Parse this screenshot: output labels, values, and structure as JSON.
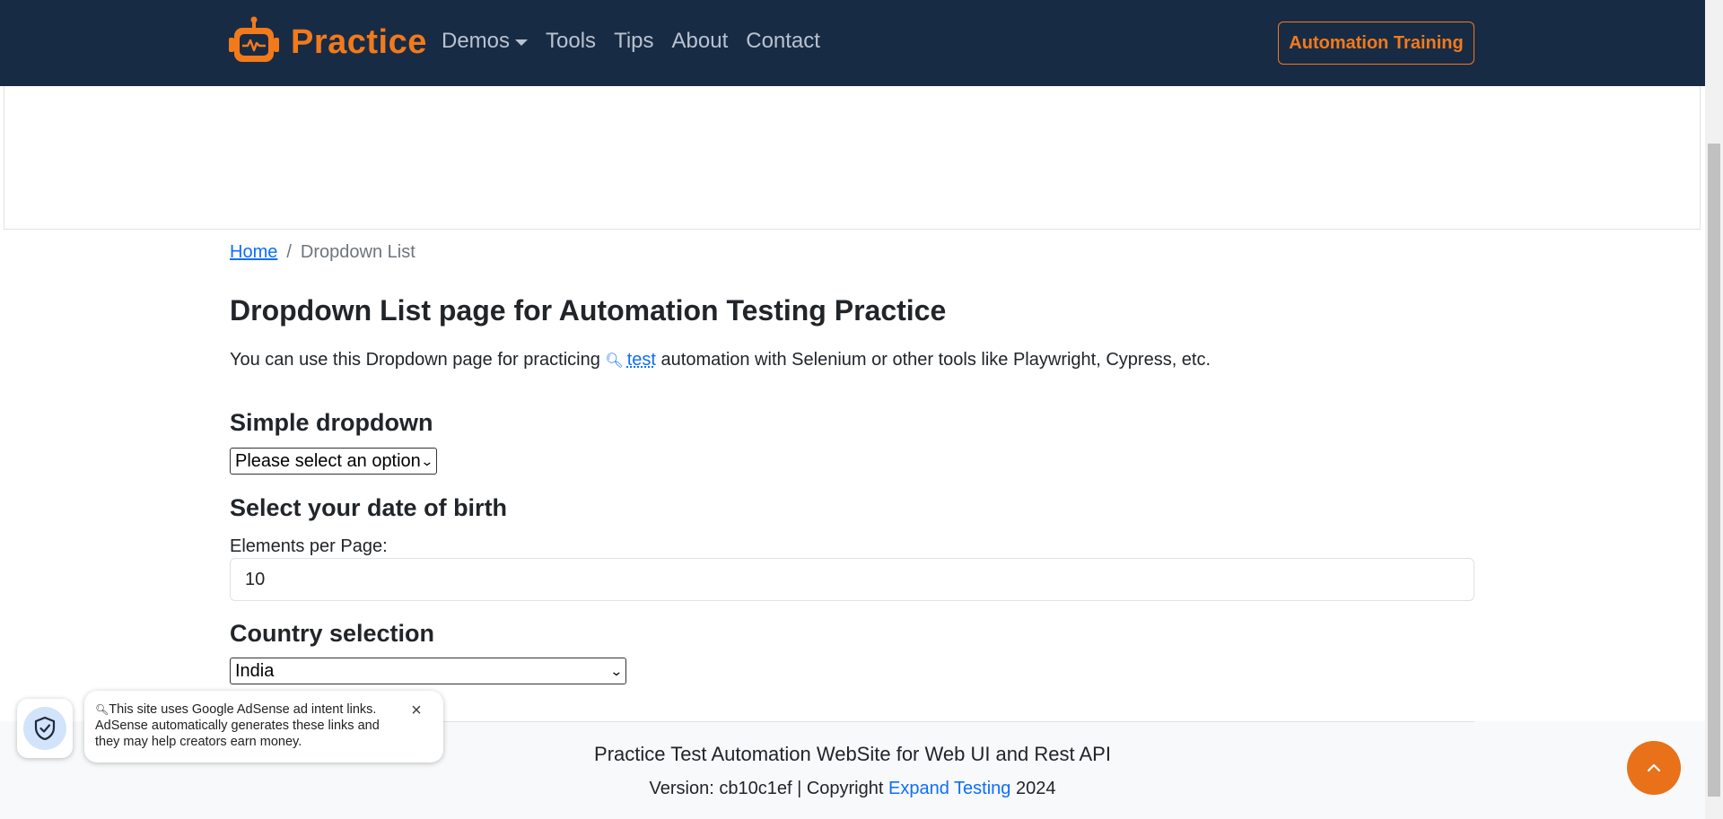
{
  "navbar": {
    "brand": "Practice",
    "links": [
      {
        "label": "Demos",
        "dropdown": true
      },
      {
        "label": "Tools",
        "dropdown": false
      },
      {
        "label": "Tips",
        "dropdown": false
      },
      {
        "label": "About",
        "dropdown": false
      },
      {
        "label": "Contact",
        "dropdown": false
      }
    ],
    "cta": "Automation Training"
  },
  "breadcrumb": {
    "home": "Home",
    "separator": "/",
    "current": "Dropdown List"
  },
  "page": {
    "title": "Dropdown List page for Automation Testing Practice",
    "intro_before": "You can use this Dropdown page for practicing",
    "intro_link": "test",
    "intro_after": "automation with Selenium or other tools like Playwright, Cypress, etc."
  },
  "simple_dropdown": {
    "heading": "Simple dropdown",
    "selected": "Please select an option"
  },
  "dob": {
    "heading": "Select your date of birth",
    "elements_label": "Elements per Page:",
    "elements_value": "10"
  },
  "country": {
    "heading": "Country selection",
    "selected": "India"
  },
  "footer": {
    "title": "Practice Test Automation WebSite for Web UI and Rest API",
    "version_prefix": "Version: cb10c1ef | Copyright",
    "company": "Expand Testing",
    "year": "2024"
  },
  "adsense": {
    "line1": "This site uses Google AdSense ad intent links.",
    "line2": "AdSense automatically generates these links and they may help creators earn money.",
    "close": "×"
  },
  "colors": {
    "navbar_bg": "#182b45",
    "brand_orange": "#f27a1a",
    "link_blue": "#0d6efd"
  },
  "icons": [
    "robot-logo-icon",
    "caret-down-icon",
    "magnifier-icon",
    "chevron-down-icon",
    "chevron-up-icon",
    "shield-check-icon",
    "close-icon"
  ]
}
